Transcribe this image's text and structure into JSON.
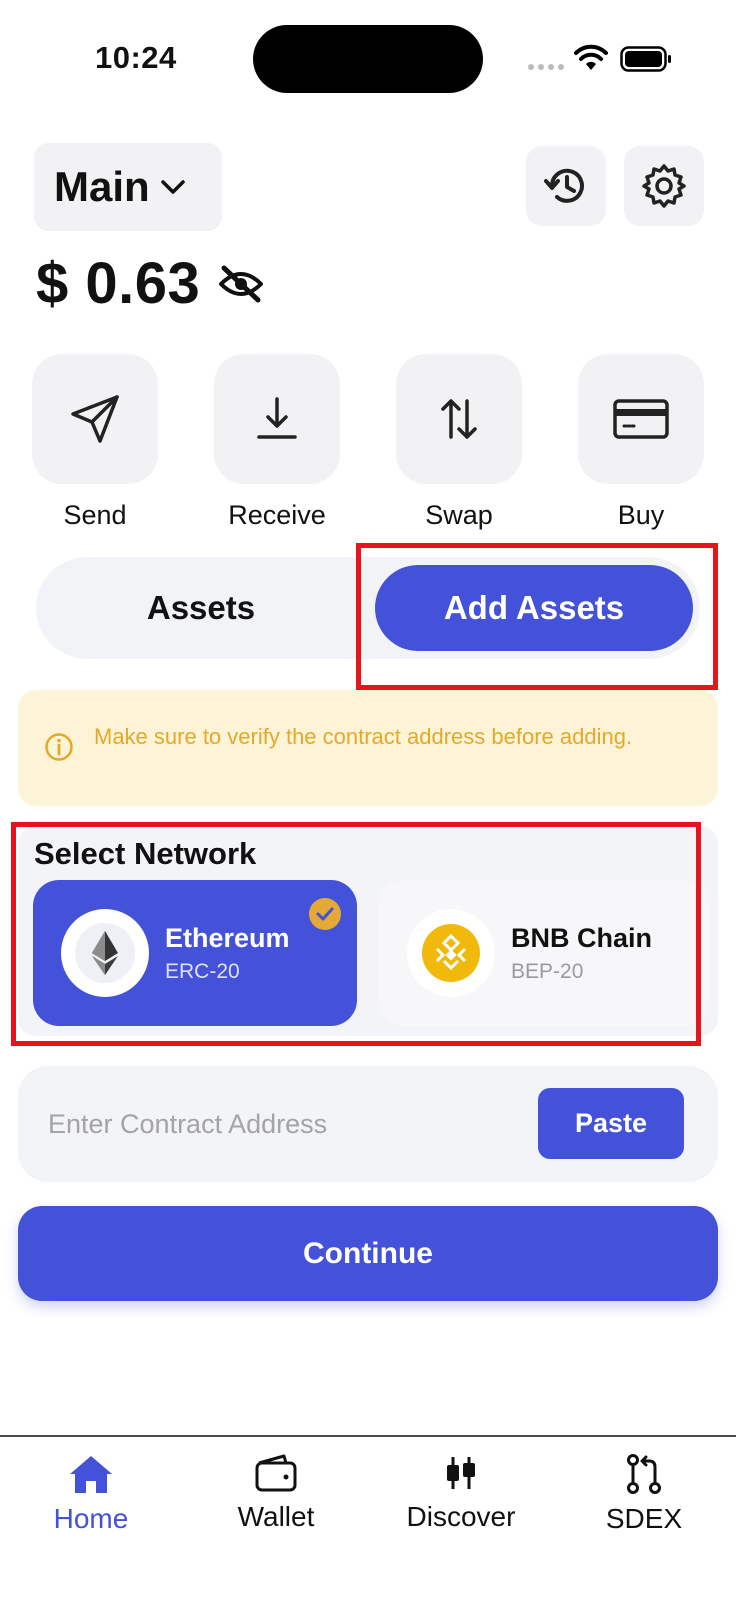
{
  "status_bar": {
    "time": "10:24"
  },
  "header": {
    "wallet_name": "Main",
    "balance": "$ 0.63"
  },
  "actions": [
    {
      "label": "Send",
      "icon": "send-icon"
    },
    {
      "label": "Receive",
      "icon": "receive-icon"
    },
    {
      "label": "Swap",
      "icon": "swap-icon"
    },
    {
      "label": "Buy",
      "icon": "card-icon"
    }
  ],
  "tabs": {
    "assets": "Assets",
    "add_assets": "Add Assets",
    "active": "Add Assets"
  },
  "notice": {
    "text": "Make sure to verify the contract address before adding."
  },
  "network": {
    "title": "Select Network",
    "options": [
      {
        "name": "Ethereum",
        "standard": "ERC-20",
        "selected": true
      },
      {
        "name": "BNB Chain",
        "standard": "BEP-20",
        "selected": false
      }
    ]
  },
  "contract": {
    "placeholder": "Enter Contract Address",
    "value": "",
    "paste_label": "Paste"
  },
  "continue_label": "Continue",
  "bottom_nav": [
    {
      "label": "Home",
      "icon": "home-icon",
      "active": true
    },
    {
      "label": "Wallet",
      "icon": "wallet-icon",
      "active": false
    },
    {
      "label": "Discover",
      "icon": "candlestick-icon",
      "active": false
    },
    {
      "label": "SDEX",
      "icon": "pull-request-icon",
      "active": false
    }
  ],
  "colors": {
    "accent": "#4352d8",
    "warning_bg": "#fdf4d8",
    "warning_text": "#e3a92a",
    "highlight": "#e8141c",
    "bnb": "#f0b90b"
  }
}
